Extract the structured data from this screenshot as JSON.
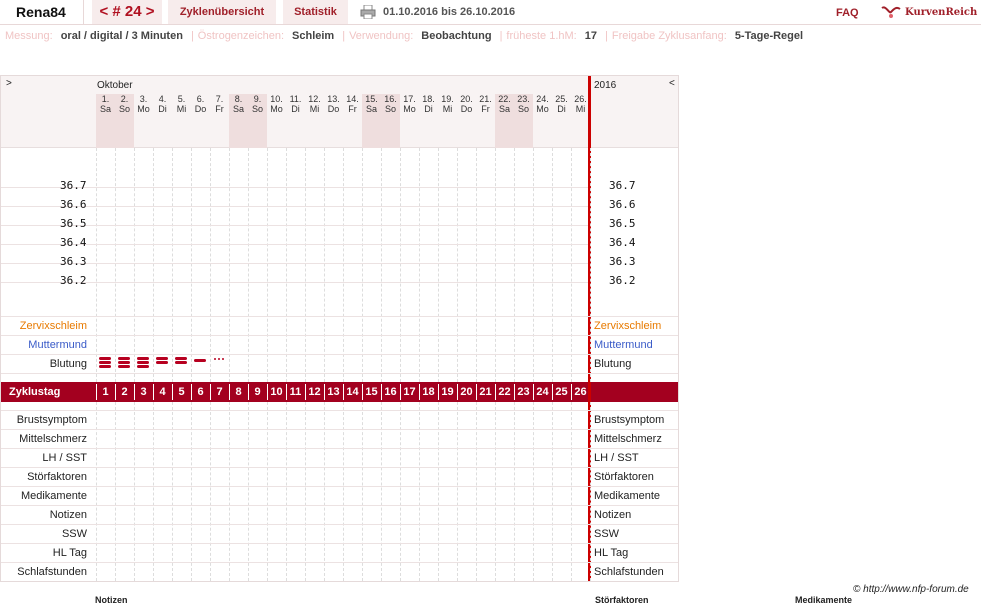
{
  "topbar": {
    "user": "Rena84",
    "cycle_nav": "< # 24 >",
    "overview_tab": "Zyklenübersicht",
    "stats_tab": "Statistik",
    "date_range": "01.10.2016 bis 26.10.2016",
    "faq": "FAQ",
    "logo_text": "KurvenReich"
  },
  "settings": [
    {
      "key": "Messung:",
      "value": "oral / digital / 3 Minuten"
    },
    {
      "key": "Östrogenzeichen:",
      "value": "Schleim"
    },
    {
      "key": "Verwendung:",
      "value": "Beobachtung"
    },
    {
      "key": "früheste 1.hM:",
      "value": "17"
    },
    {
      "key": "Freigabe Zyklusanfang:",
      "value": "5-Tage-Regel"
    }
  ],
  "chart": {
    "left_arrow": ">",
    "right_arrow": "<",
    "month": "Oktober",
    "year": "2016",
    "days": [
      {
        "n": "1.",
        "d": "Sa",
        "we": true
      },
      {
        "n": "2.",
        "d": "So",
        "we": true
      },
      {
        "n": "3.",
        "d": "Mo",
        "we": false
      },
      {
        "n": "4.",
        "d": "Di",
        "we": false
      },
      {
        "n": "5.",
        "d": "Mi",
        "we": false
      },
      {
        "n": "6.",
        "d": "Do",
        "we": false
      },
      {
        "n": "7.",
        "d": "Fr",
        "we": false
      },
      {
        "n": "8.",
        "d": "Sa",
        "we": true
      },
      {
        "n": "9.",
        "d": "So",
        "we": true
      },
      {
        "n": "10.",
        "d": "Mo",
        "we": false
      },
      {
        "n": "11.",
        "d": "Di",
        "we": false
      },
      {
        "n": "12.",
        "d": "Mi",
        "we": false
      },
      {
        "n": "13.",
        "d": "Do",
        "we": false
      },
      {
        "n": "14.",
        "d": "Fr",
        "we": false
      },
      {
        "n": "15.",
        "d": "Sa",
        "we": true
      },
      {
        "n": "16.",
        "d": "So",
        "we": true
      },
      {
        "n": "17.",
        "d": "Mo",
        "we": false
      },
      {
        "n": "18.",
        "d": "Di",
        "we": false
      },
      {
        "n": "19.",
        "d": "Mi",
        "we": false
      },
      {
        "n": "20.",
        "d": "Do",
        "we": false
      },
      {
        "n": "21.",
        "d": "Fr",
        "we": false
      },
      {
        "n": "22.",
        "d": "Sa",
        "we": true
      },
      {
        "n": "23.",
        "d": "So",
        "we": true
      },
      {
        "n": "24.",
        "d": "Mo",
        "we": false
      },
      {
        "n": "25.",
        "d": "Di",
        "we": false
      },
      {
        "n": "26.",
        "d": "Mi",
        "we": false
      }
    ],
    "temperatures": [
      "36.7",
      "36.6",
      "36.5",
      "36.4",
      "36.3",
      "36.2"
    ],
    "rows_top": [
      {
        "label": "Zervixschleim",
        "color": "#e87a00"
      },
      {
        "label": "Muttermund",
        "color": "#3a5bc8"
      },
      {
        "label": "Blutung",
        "color": "#222222"
      }
    ],
    "bleeding": [
      3,
      3,
      3,
      2,
      2,
      1,
      0.5
    ],
    "zyklustag_label": "Zyklustag",
    "cycle_days": [
      "1",
      "2",
      "3",
      "4",
      "5",
      "6",
      "7",
      "8",
      "9",
      "10",
      "11",
      "12",
      "13",
      "14",
      "15",
      "16",
      "17",
      "18",
      "19",
      "20",
      "21",
      "22",
      "23",
      "24",
      "25",
      "26"
    ],
    "rows_bottom": [
      "Brustsymptom",
      "Mittelschmerz",
      "LH / SST",
      "Störfaktoren",
      "Medikamente",
      "Notizen",
      "SSW",
      "HL Tag",
      "Schlafstunden"
    ]
  },
  "footer": {
    "copyright": "© http://www.nfp-forum.de",
    "cut_labels": [
      "Notizen",
      "Störfaktoren",
      "Medikamente"
    ]
  }
}
